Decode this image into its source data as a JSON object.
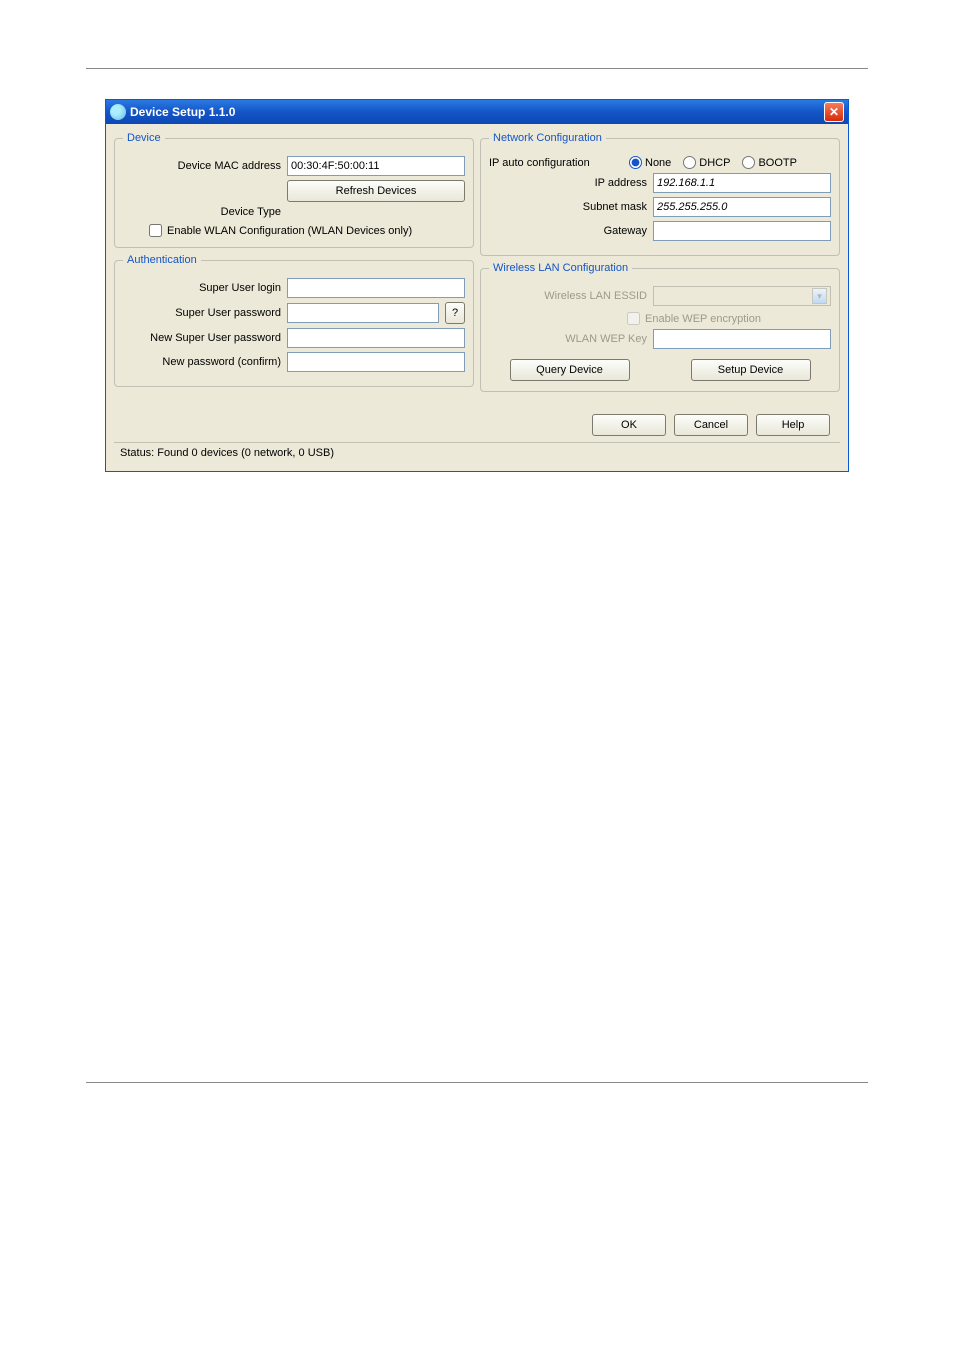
{
  "window": {
    "title": "Device Setup 1.1.0"
  },
  "device": {
    "legend": "Device",
    "mac_label": "Device MAC address",
    "mac_value": "00:30:4F:50:00:11",
    "refresh_btn": "Refresh Devices",
    "type_label": "Device Type",
    "type_value": "",
    "wlan_check_label": "Enable WLAN Configuration (WLAN Devices only)"
  },
  "network": {
    "legend": "Network Configuration",
    "ipauto_label": "IP auto configuration",
    "radio_none": "None",
    "radio_dhcp": "DHCP",
    "radio_bootp": "BOOTP",
    "ip_label": "IP address",
    "ip_value": "192.168.1.1",
    "subnet_label": "Subnet mask",
    "subnet_value": "255.255.255.0",
    "gateway_label": "Gateway",
    "gateway_value": ""
  },
  "auth": {
    "legend": "Authentication",
    "su_login_label": "Super User login",
    "su_pass_label": "Super User password",
    "new_pass_label": "New Super User password",
    "confirm_label": "New password (confirm)",
    "help_btn": "?"
  },
  "wlan": {
    "legend": "Wireless LAN Configuration",
    "essid_label": "Wireless LAN ESSID",
    "wep_check_label": "Enable WEP encryption",
    "wepkey_label": "WLAN WEP Key",
    "query_btn": "Query Device",
    "setup_btn": "Setup Device"
  },
  "buttons": {
    "ok": "OK",
    "cancel": "Cancel",
    "help": "Help"
  },
  "status": "Status: Found 0 devices (0 network, 0 USB)"
}
